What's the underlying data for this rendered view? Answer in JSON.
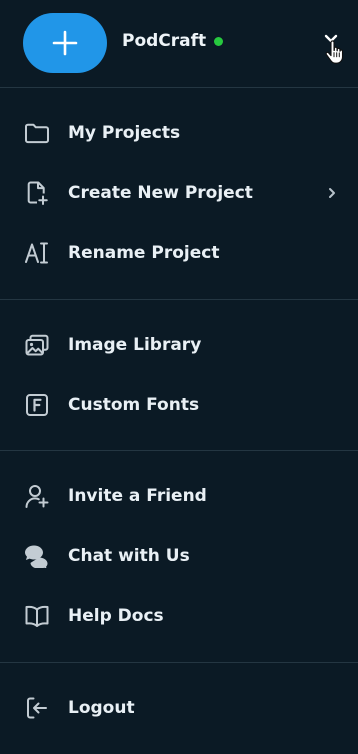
{
  "header": {
    "app_name": "PodCraft",
    "status": "online",
    "new_button_icon": "plus-icon",
    "menu_toggle_icon": "chevron-down-icon"
  },
  "menu": {
    "projects": [
      {
        "label": "My Projects",
        "icon": "folder-icon"
      },
      {
        "label": "Create New Project",
        "icon": "file-plus-icon",
        "has_submenu": true
      },
      {
        "label": "Rename Project",
        "icon": "rename-text-icon"
      }
    ],
    "assets": [
      {
        "label": "Image Library",
        "icon": "image-library-icon"
      },
      {
        "label": "Custom Fonts",
        "icon": "font-icon"
      }
    ],
    "help": [
      {
        "label": "Invite a Friend",
        "icon": "user-plus-icon"
      },
      {
        "label": "Chat with Us",
        "icon": "chat-icon"
      },
      {
        "label": "Help Docs",
        "icon": "book-icon"
      }
    ],
    "account": [
      {
        "label": "Logout",
        "icon": "logout-icon"
      }
    ]
  },
  "colors": {
    "background": "#0b1a25",
    "accent": "#2196e8",
    "status_online": "#27c93f",
    "divider": "#243642",
    "text": "#e9f0f5",
    "icon": "#c3ccd3"
  }
}
